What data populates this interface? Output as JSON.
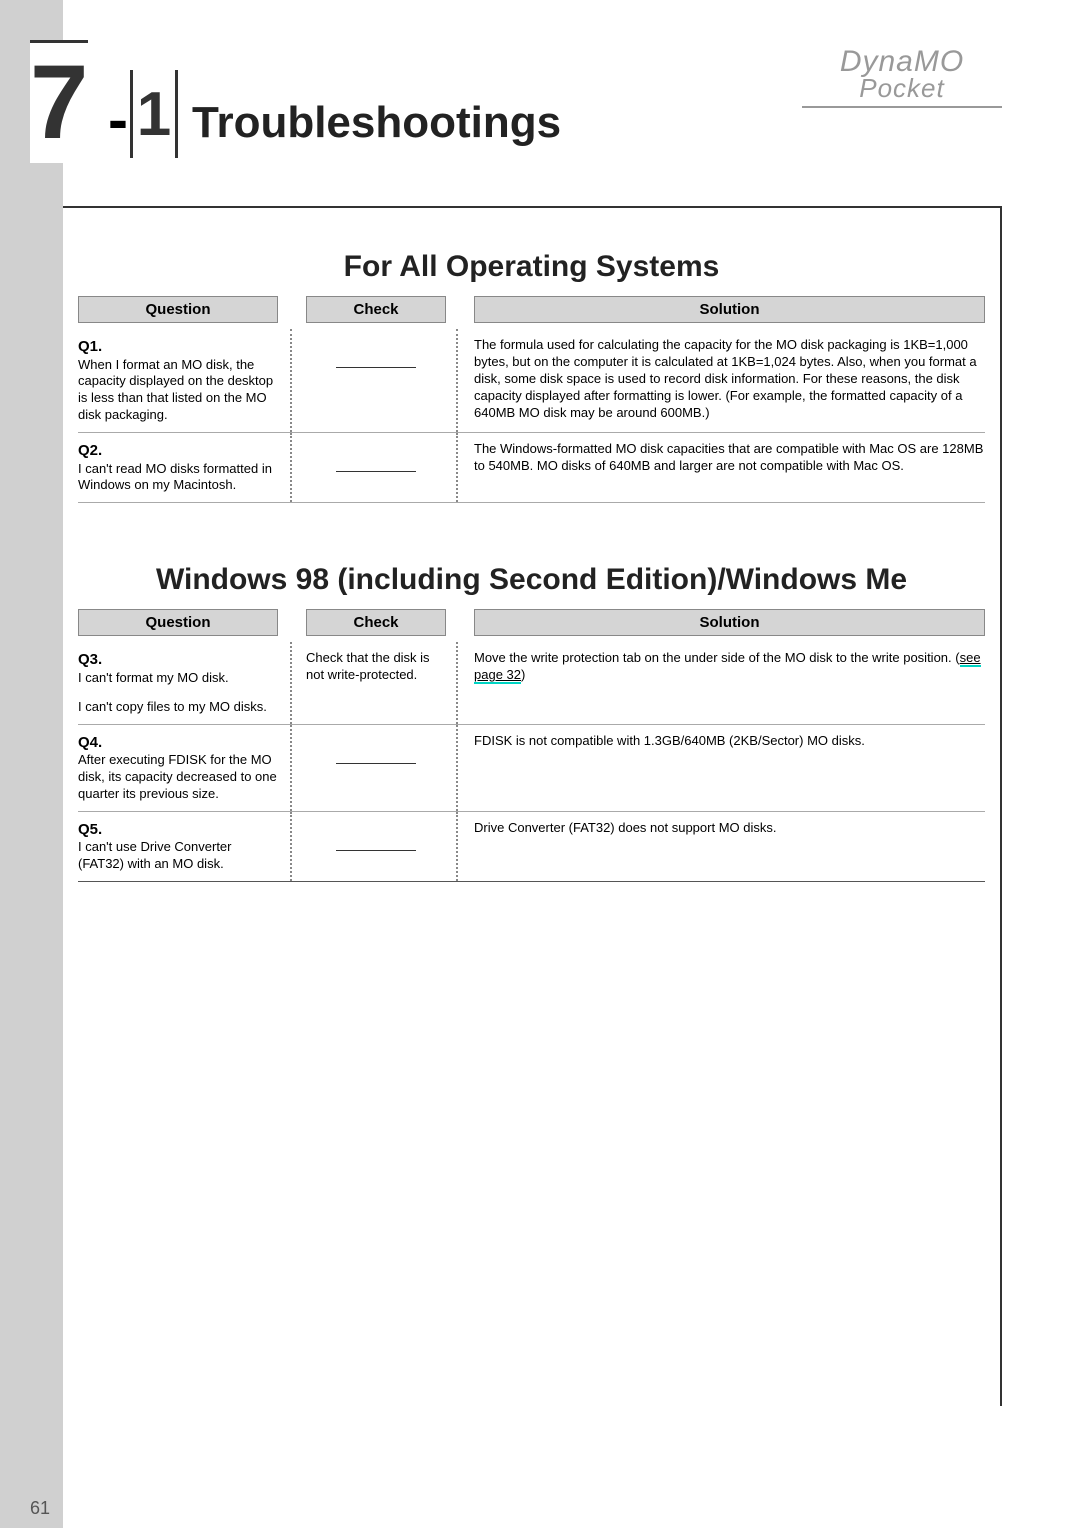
{
  "brand": {
    "top": "DynaMO",
    "bottom": "Pocket"
  },
  "section_number": {
    "chapter": "7",
    "dash": "-",
    "sub": "1"
  },
  "title": "Troubleshootings",
  "page_number": "61",
  "sections": {
    "s1": {
      "title": "For All Operating Systems",
      "headers": {
        "question": "Question",
        "check": "Check",
        "solution": "Solution"
      },
      "rows": {
        "r1": {
          "qlabel": "Q1.",
          "question": "When I format an MO disk, the capacity displayed on the desktop is less than that listed on the MO disk packaging.",
          "check": "",
          "solution": "The formula used for calculating the capacity for the MO disk packaging is 1KB=1,000 bytes, but on the computer it is calculated at 1KB=1,024 bytes.  Also, when you format a disk, some disk space is used to record disk information.  For these reasons, the disk capacity displayed after formatting is lower.  (For example, the formatted capacity of a 640MB MO disk may be around 600MB.)"
        },
        "r2": {
          "qlabel": "Q2.",
          "question": "I can't read MO disks formatted in Windows on my Macintosh.",
          "check": "",
          "solution": "The Windows-formatted MO disk capacities that are compatible with Mac OS are 128MB to 540MB.  MO disks of 640MB and larger are not compatible with Mac OS."
        }
      }
    },
    "s2": {
      "title": "Windows 98 (including Second Edition)/Windows Me",
      "headers": {
        "question": "Question",
        "check": "Check",
        "solution": "Solution"
      },
      "rows": {
        "r3": {
          "qlabel": "Q3.",
          "question_a": "I can't format my MO disk.",
          "question_b": "I can't copy files to my MO disks.",
          "check": "Check that the disk is not write-protected.",
          "solution_pre": "Move the write protection tab on the under side of the MO disk to the write position. (",
          "solution_link": "see page 32",
          "solution_post": ")"
        },
        "r4": {
          "qlabel": "Q4.",
          "question": "After executing FDISK for the MO disk, its capacity decreased to one quarter its previous size.",
          "check": "",
          "solution": "FDISK is not compatible with 1.3GB/640MB (2KB/Sector) MO disks."
        },
        "r5": {
          "qlabel": "Q5.",
          "question": "I can't use Drive Converter (FAT32) with an MO disk.",
          "check": "",
          "solution": "Drive Converter (FAT32) does not support MO disks."
        }
      }
    }
  }
}
